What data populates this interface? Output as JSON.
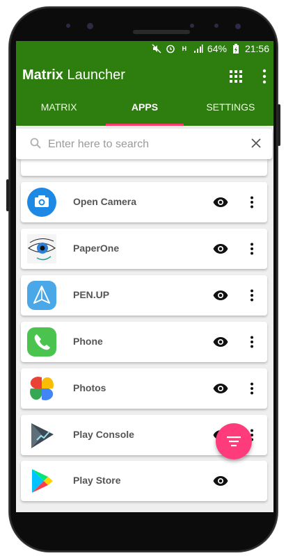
{
  "status": {
    "battery": "64%",
    "time": "21:56"
  },
  "appbar": {
    "title_bold": "Matrix",
    "title_rest": " Launcher"
  },
  "tabs": [
    {
      "label": "MATRIX"
    },
    {
      "label": "APPS"
    },
    {
      "label": "SETTINGS"
    }
  ],
  "search": {
    "placeholder": "Enter here to search",
    "value": ""
  },
  "apps": [
    {
      "name": "Open Camera",
      "icon": "camera-icon"
    },
    {
      "name": "PaperOne",
      "icon": "eye-art-icon"
    },
    {
      "name": "PEN.UP",
      "icon": "paper-plane-icon"
    },
    {
      "name": "Phone",
      "icon": "phone-icon"
    },
    {
      "name": "Photos",
      "icon": "pinwheel-icon"
    },
    {
      "name": "Play Console",
      "icon": "play-console-icon"
    },
    {
      "name": "Play Store",
      "icon": "play-store-icon"
    }
  ],
  "colors": {
    "primary": "#2e7d0f",
    "accent": "#ff3b7b"
  }
}
